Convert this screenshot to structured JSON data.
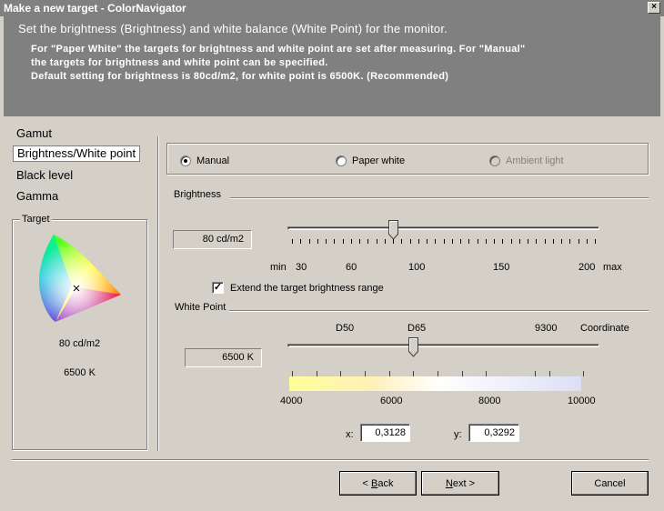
{
  "window": {
    "title": "Make a new target - ColorNavigator",
    "close_glyph": "×"
  },
  "header": {
    "title": "Set the brightness (Brightness) and white balance (White Point) for the monitor.",
    "lines": [
      "For \"Paper White\" the targets for brightness and white point are set after measuring. For \"Manual\"",
      "the targets for brightness and white point can be specified.",
      "Default setting for brightness is 80cd/m2, for white point is 6500K. (Recommended)"
    ]
  },
  "nav": {
    "items": [
      {
        "label": "Gamut"
      },
      {
        "label": "Brightness/White point",
        "selected": true
      },
      {
        "label": "Black level"
      },
      {
        "label": "Gamma"
      }
    ]
  },
  "target": {
    "label": "Target",
    "brightness": "80 cd/m2",
    "white_point": "6500 K"
  },
  "mode": {
    "options": [
      {
        "label": "Manual",
        "selected": true,
        "enabled": true
      },
      {
        "label": "Paper white",
        "selected": false,
        "enabled": true
      },
      {
        "label": "Ambient light",
        "selected": false,
        "enabled": false
      }
    ]
  },
  "brightness": {
    "label": "Brightness",
    "value": "80 cd/m2",
    "slider_value": 80,
    "range": [
      20,
      200
    ],
    "scale": {
      "min_label": "min",
      "max_label": "max",
      "marks": [
        "30",
        "60",
        "100",
        "150",
        "200"
      ]
    },
    "extend_checkbox": {
      "label": "Extend the target brightness range",
      "checked": true
    }
  },
  "white_point": {
    "label": "White Point",
    "value": "6500 K",
    "slider_value": 6500,
    "presets": [
      "D50",
      "D65",
      "9300"
    ],
    "coordinate_label": "Coordinate",
    "scale_marks": [
      "4000",
      "6000",
      "8000",
      "10000"
    ],
    "x_label": "x:",
    "x_value": "0,3128",
    "y_label": "y:",
    "y_value": "0,3292"
  },
  "buttons": {
    "back": {
      "label": "Back",
      "accel": "B",
      "prefix": "< "
    },
    "next": {
      "label": "Next",
      "accel": "N",
      "suffix": " >"
    },
    "cancel": {
      "label": "Cancel"
    }
  },
  "colors": {
    "header_bg": "#808080",
    "dialog_bg": "#d4d0c8"
  }
}
